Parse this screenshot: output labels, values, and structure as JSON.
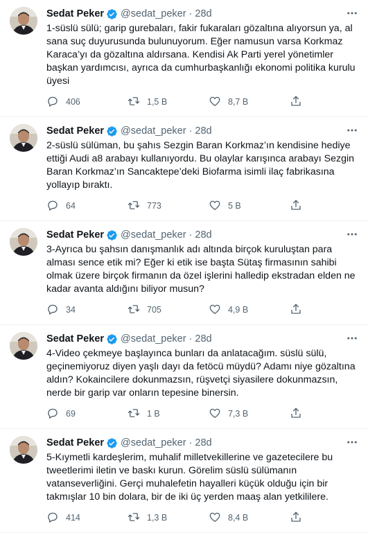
{
  "author": {
    "name": "Sedat Peker",
    "handle": "@sedat_peker",
    "verified": true
  },
  "separator": "·",
  "colors": {
    "verified_blue": "#1d9bf0",
    "secondary_text": "#536471",
    "primary_text": "#0f1419",
    "divider": "#eff3f4"
  },
  "icons": {
    "reply": "speech-bubble-icon",
    "retweet": "retweet-arrows-icon",
    "like": "heart-outline-icon",
    "share": "share-upload-icon",
    "more": "three-dots-icon",
    "verified": "verified-badge-icon"
  },
  "tweets": [
    {
      "time": "28d",
      "text": "1-süslü sülü; garip gurebaları, fakir fukaraları gözaltına alıyorsun ya, al sana suç duyurusunda bulunuyorum. Eğer namusun varsa Korkmaz Karaca’yı da gözaltına aldırsana. Kendisi Ak Parti yerel yönetimler başkan yardımcısı, ayrıca da cumhurbaşkanlığı ekonomi politika kurulu üyesi",
      "replies": "406",
      "retweets": "1,5 B",
      "likes": "8,7 B"
    },
    {
      "time": "28d",
      "text": "2-süslü sülüman, bu şahıs Sezgin Baran Korkmaz’ın kendisine hediye ettiği Audi a8 arabayı kullanıyordu. Bu olaylar karışınca arabayı Sezgin Baran Korkmaz’ın Sancaktepe’deki Biofarma isimli ilaç fabrikasına yollayıp bıraktı.",
      "replies": "64",
      "retweets": "773",
      "likes": "5 B"
    },
    {
      "time": "28d",
      "text": "3-Ayrıca bu şahsın danışmanlık adı altında birçok kuruluştan para alması sence etik mi? Eğer ki etik ise başta Sütaş firmasının sahibi olmak üzere birçok firmanın da özel işlerini halledip ekstradan elden ne kadar avanta aldığını biliyor musun?",
      "replies": "34",
      "retweets": "705",
      "likes": "4,9 B"
    },
    {
      "time": "28d",
      "text": "4-Video çekmeye başlayınca bunları da anlatacağım. süslü sülü, geçinemiyoruz diyen yaşlı dayı da fetöcü müydü? Adamı niye gözaltına aldın? Kokaincilere dokunmazsın, rüşvetçi siyasilere dokunmazsın, nerde bir garip var onların tepesine binersin.",
      "replies": "69",
      "retweets": "1 B",
      "likes": "7,3 B"
    },
    {
      "time": "28d",
      "text": "5-Kıymetli kardeşlerim, muhalif milletvekillerine ve gazetecilere bu tweetlerimi iletin ve baskı kurun. Görelim süslü sülümanın vatanseverliğini. Gerçi muhalefetin hayalleri küçük olduğu için bir takmışlar 10 bin dolara, bir de iki üç yerden maaş alan yetkililere.",
      "replies": "414",
      "retweets": "1,3 B",
      "likes": "8,4 B"
    }
  ]
}
